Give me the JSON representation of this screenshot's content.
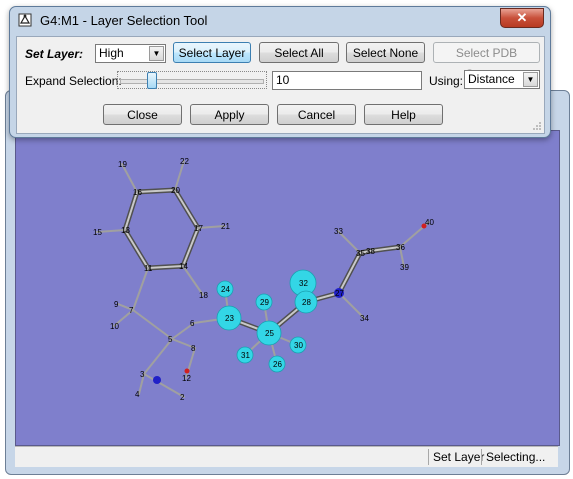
{
  "window": {
    "title": "G4:M1 - Layer Selection Tool",
    "close_glyph": "✕"
  },
  "row1": {
    "set_layer_label": "Set Layer:",
    "layer_value": "High",
    "select_layer_label": "Select Layer",
    "select_all_label": "Select All",
    "select_none_label": "Select None",
    "select_pdb_label": "Select PDB Group..."
  },
  "row2": {
    "expand_label": "Expand Selection:",
    "expand_slider_fraction": 0.2,
    "expand_value": "10",
    "using_label": "Using:",
    "using_value": "Distance"
  },
  "buttons": {
    "close": "Close",
    "apply": "Apply",
    "cancel": "Cancel",
    "help": "Help"
  },
  "status": {
    "set_layer": "Set Layer",
    "selecting": "Selecting..."
  },
  "colors": {
    "viewport_bg": "#7f7fcc",
    "bond_gray": "#a0a0a0",
    "selected_atom": "#33d6e6",
    "nitrogen": "#2020c8",
    "oxygen": "#d02020"
  },
  "molecule": {
    "atom_labels": [
      "19",
      "22",
      "16",
      "20",
      "15",
      "13",
      "17",
      "21",
      "11",
      "14",
      "18",
      "9",
      "7",
      "10",
      "6",
      "5",
      "8",
      "3",
      "4",
      "2",
      "12",
      "24",
      "29",
      "23",
      "25",
      "31",
      "26",
      "30",
      "32",
      "28",
      "34",
      "27",
      "35",
      "38",
      "33",
      "36",
      "39",
      "40"
    ]
  }
}
